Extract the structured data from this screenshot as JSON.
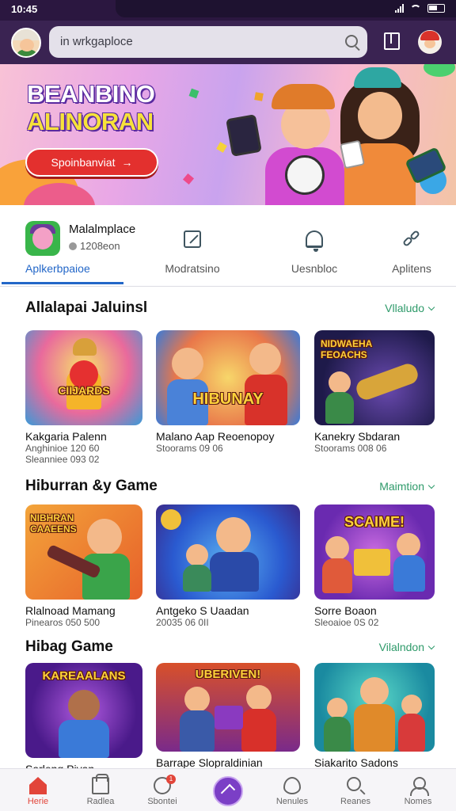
{
  "status_bar": {
    "time": "10:45"
  },
  "header": {
    "search_placeholder": "in wrkgaploce",
    "icons": [
      "avatar",
      "search-icon",
      "bookmark-icon",
      "mascot-icon"
    ]
  },
  "hero": {
    "title_line1": "BEANBINO",
    "title_line2": "ALINORAN",
    "button_label": "Spoinbanviat"
  },
  "category_tabs": {
    "store_name": "Malalmplace",
    "store_rating": "1208eon",
    "active_tab": "Aplkerbpaioe",
    "tabs": [
      {
        "label": "Modratsino",
        "icon": "pencil-square-icon"
      },
      {
        "label": "Uesnbloc",
        "icon": "bell-icon"
      },
      {
        "label": "Aplitens",
        "icon": "link-icon"
      }
    ]
  },
  "sections": [
    {
      "title": "Allalapai Jaluinsl",
      "link": "Vllaludo",
      "cards": [
        {
          "thumb_text": "CIIJARDS",
          "title": "Kakgaria Palenn",
          "sub1": "Anghinioe 120 60",
          "sub2": "Sleanniee 093 02"
        },
        {
          "thumb_text": "HIBUNAY",
          "title": "Malano Aap Reoenopoy",
          "sub1": "Stoorams 09 06",
          "sub2": ""
        },
        {
          "thumb_text": "NIDWAEHA FEOACHS",
          "title": "Kanekry Sbdaran",
          "sub1": "Stoorams 008 06",
          "sub2": ""
        }
      ]
    },
    {
      "title": "Hiburran &y Game",
      "link": "Maimtion",
      "cards": [
        {
          "thumb_text": "NIBHRAN CAAEENS",
          "title": "Rlalnoad Mamang",
          "sub1": "Pinearos 050 500",
          "sub2": ""
        },
        {
          "thumb_text": "",
          "title": "Antgeko S Uaadan",
          "sub1": "20035 06 0II",
          "sub2": ""
        },
        {
          "thumb_text": "SCAIME!",
          "title": "Sorre Boaon",
          "sub1": "Sleoaioe 0S 02",
          "sub2": ""
        }
      ]
    },
    {
      "title": "Hibag Game",
      "link": "Vilalndon",
      "cards": [
        {
          "thumb_text": "KAREAALANS",
          "title": "Sarleng Piyan",
          "sub1": "",
          "sub2": ""
        },
        {
          "thumb_text": "UBERIVEN!",
          "title": "Barrape Slopraldinian",
          "sub1": "",
          "sub2": ""
        },
        {
          "thumb_text": "",
          "title": "Siakarito Sadons",
          "sub1": "",
          "sub2": ""
        }
      ]
    }
  ],
  "bottom_nav": [
    {
      "label": "Herie",
      "icon": "home-icon",
      "active": true
    },
    {
      "label": "Radlea",
      "icon": "box-icon"
    },
    {
      "label": "Sbontei",
      "icon": "chat-icon",
      "badge": "1"
    },
    {
      "label": "",
      "icon": "upload-icon"
    },
    {
      "label": "Nenules",
      "icon": "heart-icon"
    },
    {
      "label": "Reanes",
      "icon": "search-icon"
    },
    {
      "label": "Nomes",
      "icon": "person-icon"
    }
  ],
  "colors": {
    "header_bg": "#3a2352",
    "accent_green": "#2e9a6a",
    "tab_active": "#2367c8",
    "hero_button": "#e3302e",
    "nav_center": "#7b3fc6"
  }
}
